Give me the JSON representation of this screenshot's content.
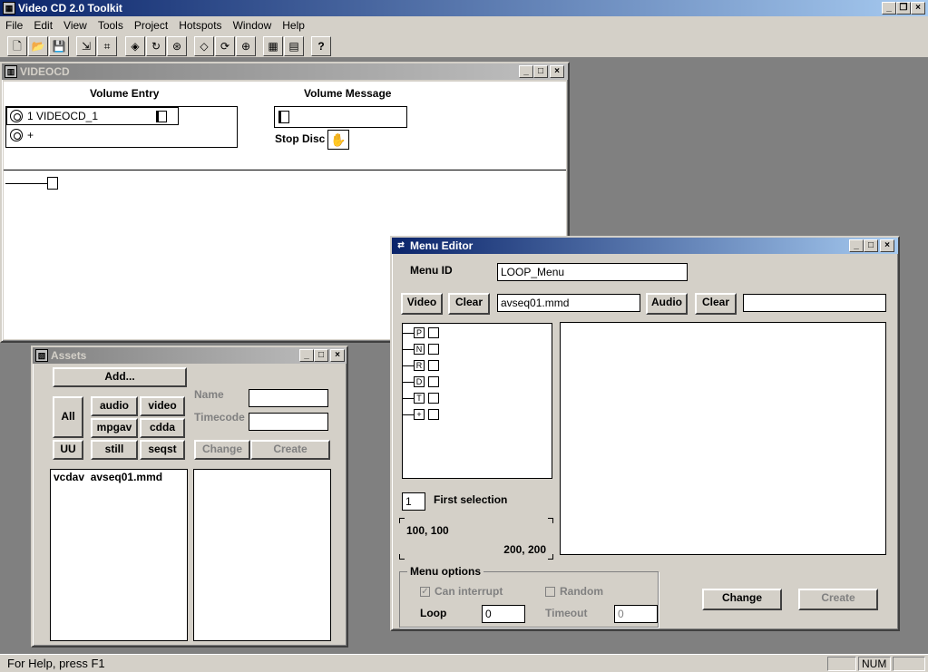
{
  "app": {
    "title": "Video CD 2.0 Toolkit"
  },
  "menu": [
    "File",
    "Edit",
    "View",
    "Tools",
    "Project",
    "Hotspots",
    "Window",
    "Help"
  ],
  "toolbar": {
    "icons": [
      "new-file-icon",
      "open-folder-icon",
      "save-icon",
      "import-icon",
      "hotspot-icon",
      "rotate-icon",
      "globe-icon",
      "target-icon",
      "refresh-icon",
      "network-icon",
      "grid-icon",
      "form-icon",
      "help-icon"
    ],
    "help_glyph": "?"
  },
  "videocd": {
    "title": "VIDEOCD",
    "volume_entry_label": "Volume Entry",
    "volume_message_label": "Volume Message",
    "entries": [
      "1 VIDEOCD_1",
      "+"
    ],
    "stop_disc_label": "Stop Disc"
  },
  "assets": {
    "title": "Assets",
    "add_label": "Add...",
    "all_label": "All",
    "uu_label": "UU",
    "type_buttons": [
      "audio",
      "video",
      "mpgav",
      "cdda",
      "still",
      "seqst"
    ],
    "name_label": "Name",
    "timecode_label": "Timecode",
    "change_label": "Change",
    "create_label": "Create",
    "list_items": [
      "vcdav  avseq01.mmd"
    ]
  },
  "menu_editor": {
    "title": "Menu Editor",
    "menu_id_label": "Menu ID",
    "menu_id_value": "LOOP_Menu",
    "video_label": "Video",
    "clear_label": "Clear",
    "video_file": "avseq01.mmd",
    "audio_label": "Audio",
    "audio_file": "",
    "tree_nodes": [
      "P",
      "N",
      "R",
      "D",
      "T",
      "+"
    ],
    "first_selection_value": "1",
    "first_selection_label": "First selection",
    "coord_top_left": "100, 100",
    "coord_bottom_right": "200, 200",
    "menu_options_label": "Menu options",
    "can_interrupt_label": "Can interrupt",
    "random_label": "Random",
    "loop_label": "Loop",
    "loop_value": "0",
    "timeout_label": "Timeout",
    "timeout_value": "0",
    "change_label": "Change",
    "create_label": "Create"
  },
  "status": {
    "help_text": "For Help, press F1",
    "num": "NUM"
  }
}
